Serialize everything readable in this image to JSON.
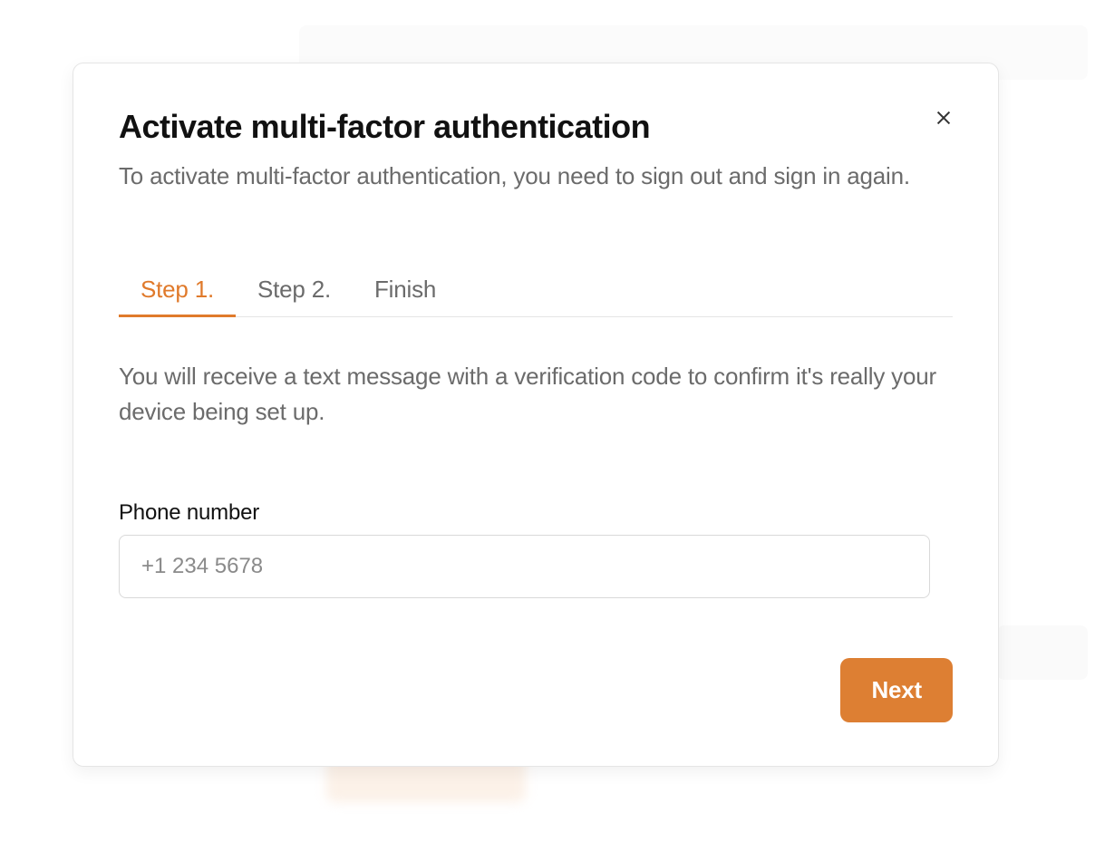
{
  "modal": {
    "title": "Activate multi-factor authentication",
    "subtitle": "To activate multi-factor authentication, you need to sign out and sign in again.",
    "close_icon": "close-icon"
  },
  "tabs": [
    {
      "label": "Step 1.",
      "active": true
    },
    {
      "label": "Step 2.",
      "active": false
    },
    {
      "label": "Finish",
      "active": false
    }
  ],
  "step1": {
    "description": "You will receive a text message with a verification code to confirm it's really your device being set up.",
    "phone_label": "Phone number",
    "phone_placeholder": "+1 234 5678",
    "phone_value": ""
  },
  "footer": {
    "next_label": "Next"
  },
  "colors": {
    "accent": "#e07a2b",
    "text_primary": "#111111",
    "text_secondary": "#6b6b6b",
    "border": "#e5e5e5"
  }
}
